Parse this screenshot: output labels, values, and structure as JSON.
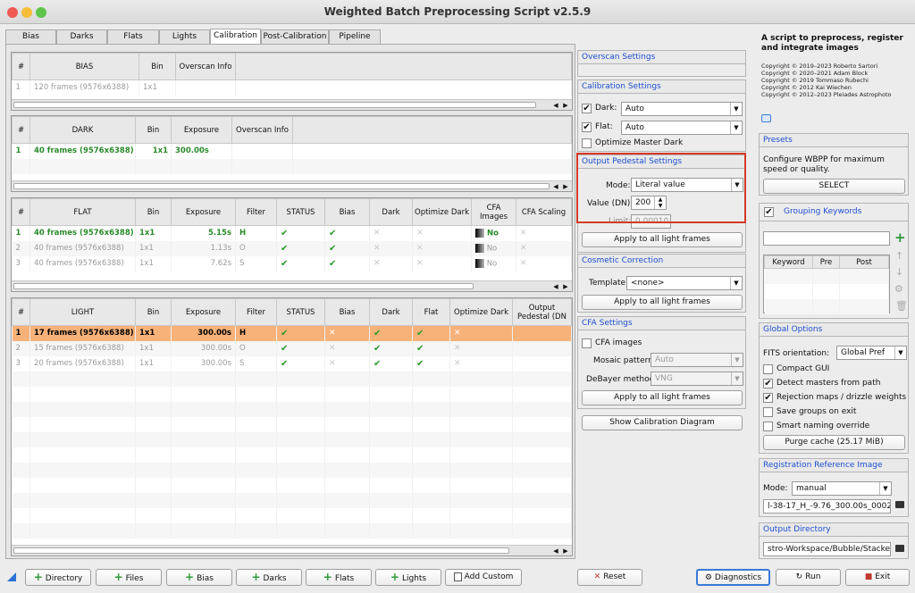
{
  "window": {
    "title": "Weighted Batch Preprocessing Script v2.5.9"
  },
  "tabs": [
    "Bias",
    "Darks",
    "Flats",
    "Lights",
    "Calibration",
    "Post-Calibration",
    "Pipeline"
  ],
  "bias": {
    "headers": [
      "#",
      "BIAS",
      "Bin",
      "Overscan Info"
    ],
    "rows": [
      [
        "1",
        "120 frames (9576x6388)",
        "1x1",
        ""
      ]
    ]
  },
  "dark": {
    "headers": [
      "#",
      "DARK",
      "Bin",
      "Exposure",
      "Overscan Info"
    ],
    "rows": [
      [
        "1",
        "40 frames (9576x6388)",
        "1x1",
        "300.00s",
        ""
      ]
    ]
  },
  "flat": {
    "headers": [
      "#",
      "FLAT",
      "Bin",
      "Exposure",
      "Filter",
      "STATUS",
      "Bias",
      "Dark",
      "Optimize Dark",
      "CFA Images",
      "CFA Scaling"
    ],
    "rows": [
      [
        "1",
        "40 frames (9576x6388)",
        "1x1",
        "5.15s",
        "H",
        "No"
      ],
      [
        "2",
        "40 frames (9576x6388)",
        "1x1",
        "1.13s",
        "O",
        "No"
      ],
      [
        "3",
        "40 frames (9576x6388)",
        "1x1",
        "7.62s",
        "S",
        "No"
      ]
    ]
  },
  "light": {
    "headers": [
      "#",
      "LIGHT",
      "Bin",
      "Exposure",
      "Filter",
      "STATUS",
      "Bias",
      "Dark",
      "Flat",
      "Optimize Dark",
      "Output Pedestal (DN"
    ],
    "rows": [
      [
        "1",
        "17 frames (9576x6388)",
        "1x1",
        "300.00s",
        "H"
      ],
      [
        "2",
        "15 frames (9576x6388)",
        "1x1",
        "300.00s",
        "O"
      ],
      [
        "3",
        "20 frames (9576x6388)",
        "1x1",
        "300.00s",
        "S"
      ]
    ]
  },
  "overscan": {
    "title": "Overscan Settings"
  },
  "calibration": {
    "title": "Calibration Settings",
    "dark_label": "Dark:",
    "dark_value": "Auto",
    "flat_label": "Flat:",
    "flat_value": "Auto",
    "optimize_label": "Optimize Master Dark"
  },
  "pedestal": {
    "title": "Output Pedestal Settings",
    "mode_label": "Mode:",
    "mode_value": "Literal value",
    "value_label": "Value (DN):",
    "value": "200",
    "limit_label": "Limit:",
    "limit_value": "0.00010",
    "apply": "Apply to all light frames"
  },
  "cosmetic": {
    "title": "Cosmetic Correction",
    "template_label": "Template:",
    "template_value": "<none>",
    "apply": "Apply to all light frames"
  },
  "cfa": {
    "title": "CFA Settings",
    "images_label": "CFA images",
    "mosaic_label": "Mosaic pattern:",
    "mosaic_value": "Auto",
    "debayer_label": "DeBayer method:",
    "debayer_value": "VNG",
    "apply": "Apply to all light frames"
  },
  "show_diagram": "Show Calibration Diagram",
  "description": "A script to preprocess, register and integrate images",
  "copyright": [
    "Copyright © 2019–2023 Roberto Sartori",
    "Copyright © 2020–2021 Adam Block",
    "Copyright © 2019 Tommaso Rubechi",
    "Copyright © 2012 Kai Wiechen",
    "Copyright © 2012–2023 Pleiades Astrophoto"
  ],
  "presets": {
    "title": "Presets",
    "text": "Configure WBPP for maximum speed or quality.",
    "select": "SELECT"
  },
  "grouping": {
    "title": "Grouping Keywords",
    "cols": [
      "Keyword",
      "Pre",
      "Post"
    ]
  },
  "global": {
    "title": "Global Options",
    "fits_label": "FITS orientation:",
    "fits_value": "Global Pref",
    "options": [
      {
        "label": "Compact GUI",
        "checked": false
      },
      {
        "label": "Detect masters from path",
        "checked": true
      },
      {
        "label": "Rejection maps / drizzle weights",
        "checked": true
      },
      {
        "label": "Save groups on exit",
        "checked": false
      },
      {
        "label": "Smart naming override",
        "checked": false
      }
    ],
    "purge": "Purge cache (25.17 MiB)"
  },
  "registration": {
    "title": "Registration Reference Image",
    "mode_label": "Mode:",
    "mode_value": "manual",
    "file": "l-38-17_H_-9.76_300.00s_0002.fits"
  },
  "output": {
    "title": "Output Directory",
    "path": "stro-Workspace/Bubble/Stacked-IV"
  },
  "bottom": {
    "directory": "Directory",
    "files": "Files",
    "bias": "Bias",
    "darks": "Darks",
    "flats": "Flats",
    "lights": "Lights",
    "add_custom": "Add Custom",
    "reset": "Reset",
    "diagnostics": "Diagnostics",
    "run": "Run",
    "exit": "Exit"
  },
  "colors": {
    "accent": "#1f4fd0",
    "selected_row": "#f7b27a",
    "highlight": "#d43a2a",
    "green": "#2a8a2a"
  }
}
